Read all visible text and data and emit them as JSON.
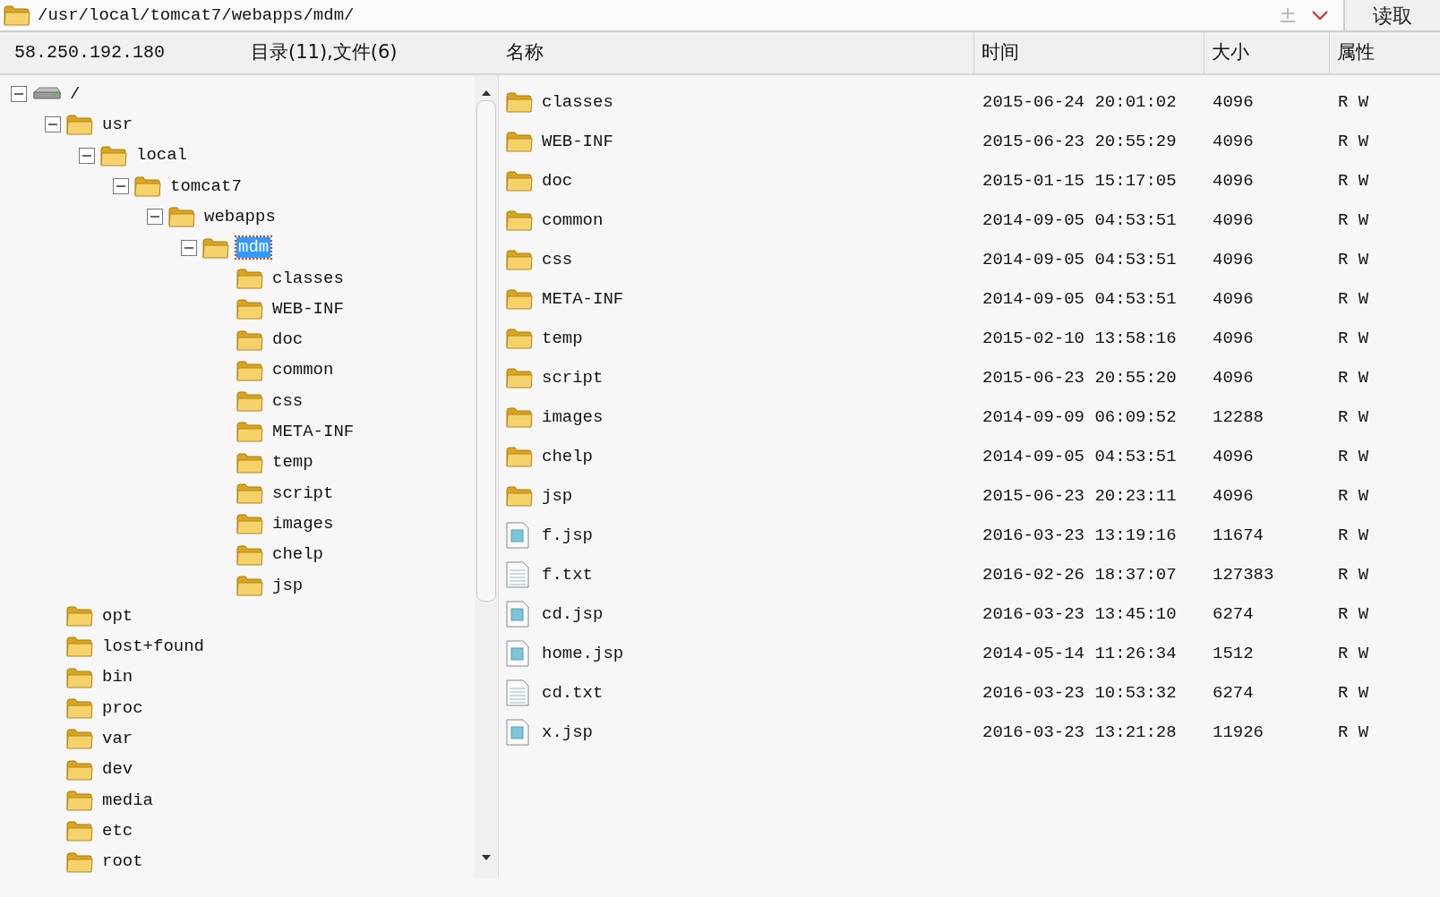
{
  "address_bar": {
    "path": "/usr/local/tomcat7/webapps/mdm/",
    "read_button": "读取"
  },
  "header": {
    "host": "58.250.192.180",
    "summary": "目录(11),文件(6)",
    "columns": [
      "名称",
      "时间",
      "大小",
      "属性"
    ]
  },
  "tree": [
    {
      "label": "/",
      "kind": "drive",
      "expanded": true,
      "selected": false,
      "children": [
        {
          "label": "usr",
          "kind": "folder",
          "expanded": true,
          "selected": false,
          "children": [
            {
              "label": "local",
              "kind": "folder",
              "expanded": true,
              "selected": false,
              "children": [
                {
                  "label": "tomcat7",
                  "kind": "folder",
                  "expanded": true,
                  "selected": false,
                  "children": [
                    {
                      "label": "webapps",
                      "kind": "folder",
                      "expanded": true,
                      "selected": false,
                      "children": [
                        {
                          "label": "mdm",
                          "kind": "folder",
                          "expanded": true,
                          "selected": true,
                          "children": [
                            {
                              "label": "classes",
                              "kind": "folder",
                              "expanded": false,
                              "selected": false
                            },
                            {
                              "label": "WEB-INF",
                              "kind": "folder",
                              "expanded": false,
                              "selected": false
                            },
                            {
                              "label": "doc",
                              "kind": "folder",
                              "expanded": false,
                              "selected": false
                            },
                            {
                              "label": "common",
                              "kind": "folder",
                              "expanded": false,
                              "selected": false
                            },
                            {
                              "label": "css",
                              "kind": "folder",
                              "expanded": false,
                              "selected": false
                            },
                            {
                              "label": "META-INF",
                              "kind": "folder",
                              "expanded": false,
                              "selected": false
                            },
                            {
                              "label": "temp",
                              "kind": "folder",
                              "expanded": false,
                              "selected": false
                            },
                            {
                              "label": "script",
                              "kind": "folder",
                              "expanded": false,
                              "selected": false
                            },
                            {
                              "label": "images",
                              "kind": "folder",
                              "expanded": false,
                              "selected": false
                            },
                            {
                              "label": "chelp",
                              "kind": "folder",
                              "expanded": false,
                              "selected": false
                            },
                            {
                              "label": "jsp",
                              "kind": "folder",
                              "expanded": false,
                              "selected": false
                            }
                          ]
                        }
                      ]
                    }
                  ]
                }
              ]
            }
          ]
        },
        {
          "label": "opt",
          "kind": "folder",
          "expanded": false,
          "selected": false
        },
        {
          "label": "lost+found",
          "kind": "folder",
          "expanded": false,
          "selected": false
        },
        {
          "label": "bin",
          "kind": "folder",
          "expanded": false,
          "selected": false
        },
        {
          "label": "proc",
          "kind": "folder",
          "expanded": false,
          "selected": false
        },
        {
          "label": "var",
          "kind": "folder",
          "expanded": false,
          "selected": false
        },
        {
          "label": "dev",
          "kind": "folder",
          "expanded": false,
          "selected": false
        },
        {
          "label": "media",
          "kind": "folder",
          "expanded": false,
          "selected": false
        },
        {
          "label": "etc",
          "kind": "folder",
          "expanded": false,
          "selected": false
        },
        {
          "label": "root",
          "kind": "folder",
          "expanded": false,
          "selected": false
        }
      ]
    }
  ],
  "files": [
    {
      "name": "classes",
      "kind": "folder",
      "time": "2015-06-24 20:01:02",
      "size": "4096",
      "attributes": "R W"
    },
    {
      "name": "WEB-INF",
      "kind": "folder",
      "time": "2015-06-23 20:55:29",
      "size": "4096",
      "attributes": "R W"
    },
    {
      "name": "doc",
      "kind": "folder",
      "time": "2015-01-15 15:17:05",
      "size": "4096",
      "attributes": "R W"
    },
    {
      "name": "common",
      "kind": "folder",
      "time": "2014-09-05 04:53:51",
      "size": "4096",
      "attributes": "R W"
    },
    {
      "name": "css",
      "kind": "folder",
      "time": "2014-09-05 04:53:51",
      "size": "4096",
      "attributes": "R W"
    },
    {
      "name": "META-INF",
      "kind": "folder",
      "time": "2014-09-05 04:53:51",
      "size": "4096",
      "attributes": "R W"
    },
    {
      "name": "temp",
      "kind": "folder",
      "time": "2015-02-10 13:58:16",
      "size": "4096",
      "attributes": "R W"
    },
    {
      "name": "script",
      "kind": "folder",
      "time": "2015-06-23 20:55:20",
      "size": "4096",
      "attributes": "R W"
    },
    {
      "name": "images",
      "kind": "folder",
      "time": "2014-09-09 06:09:52",
      "size": "12288",
      "attributes": "R W"
    },
    {
      "name": "chelp",
      "kind": "folder",
      "time": "2014-09-05 04:53:51",
      "size": "4096",
      "attributes": "R W"
    },
    {
      "name": "jsp",
      "kind": "folder",
      "time": "2015-06-23 20:23:11",
      "size": "4096",
      "attributes": "R W"
    },
    {
      "name": "f.jsp",
      "kind": "script",
      "time": "2016-03-23 13:19:16",
      "size": "11674",
      "attributes": "R W"
    },
    {
      "name": "f.txt",
      "kind": "text",
      "time": "2016-02-26 18:37:07",
      "size": "127383",
      "attributes": "R W"
    },
    {
      "name": "cd.jsp",
      "kind": "script",
      "time": "2016-03-23 13:45:10",
      "size": "6274",
      "attributes": "R W"
    },
    {
      "name": "home.jsp",
      "kind": "script",
      "time": "2014-05-14 11:26:34",
      "size": "1512",
      "attributes": "R W"
    },
    {
      "name": "cd.txt",
      "kind": "text",
      "time": "2016-03-23 10:53:32",
      "size": "6274",
      "attributes": "R W"
    },
    {
      "name": "x.jsp",
      "kind": "script",
      "time": "2016-03-23 13:21:28",
      "size": "11926",
      "attributes": "R W"
    }
  ]
}
